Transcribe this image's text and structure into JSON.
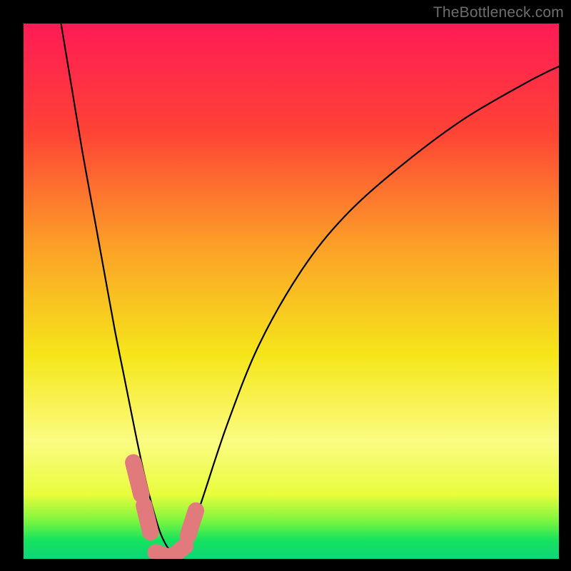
{
  "watermark": "TheBottleneck.com",
  "chart_data": {
    "type": "line",
    "title": "",
    "xlabel": "",
    "ylabel": "",
    "xlim": [
      0,
      100
    ],
    "ylim": [
      0,
      100
    ],
    "gradient_stops": [
      {
        "offset": 0,
        "color": "#ff1b55"
      },
      {
        "offset": 0.2,
        "color": "#fe4236"
      },
      {
        "offset": 0.42,
        "color": "#fca227"
      },
      {
        "offset": 0.62,
        "color": "#f5e61a"
      },
      {
        "offset": 0.78,
        "color": "#fbfc82"
      },
      {
        "offset": 0.88,
        "color": "#e8fd3c"
      },
      {
        "offset": 0.93,
        "color": "#7af53f"
      },
      {
        "offset": 0.965,
        "color": "#15e35e"
      },
      {
        "offset": 1.0,
        "color": "#0fd477"
      }
    ],
    "series": [
      {
        "name": "curve",
        "x": [
          7,
          9,
          11,
          13,
          15,
          17,
          19,
          21,
          22.5,
          24,
          25.5,
          27,
          28.5,
          30,
          33,
          38,
          44,
          52,
          60,
          70,
          82,
          94,
          100
        ],
        "y": [
          100,
          88,
          76,
          65,
          54,
          43,
          33,
          23,
          16,
          10,
          5,
          2,
          0.5,
          2,
          10,
          25,
          40,
          54,
          64,
          73,
          82,
          89,
          92
        ]
      }
    ],
    "markers": [
      {
        "x1": 20.5,
        "y1": 18,
        "x2": 22.0,
        "y2": 12
      },
      {
        "x1": 22.5,
        "y1": 10,
        "x2": 23.7,
        "y2": 5
      },
      {
        "x1": 24.7,
        "y1": 1.2,
        "x2": 27.0,
        "y2": 0.4
      },
      {
        "x1": 28.0,
        "y1": 0.6,
        "x2": 30.2,
        "y2": 2.4
      },
      {
        "x1": 30.7,
        "y1": 4.3,
        "x2": 32.2,
        "y2": 9.0
      }
    ],
    "marker_color": "#e17a7c",
    "marker_width": 3.1
  }
}
